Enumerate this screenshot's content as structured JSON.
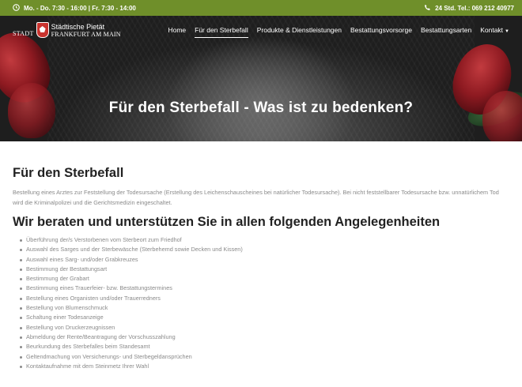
{
  "topbar": {
    "hours": "Mo. - Do. 7:30 - 16:00 | Fr. 7:30 - 14:00",
    "phone": "24 Std. Tel.: 069 212 40977",
    "clock_icon": "clock-icon",
    "phone_icon": "phone-icon"
  },
  "logo": {
    "stadt": "STADT",
    "line1": "Städtische Pietät",
    "line2": "FRANKFURT AM MAIN"
  },
  "nav": {
    "items": [
      {
        "label": "Home"
      },
      {
        "label": "Für den Sterbefall"
      },
      {
        "label": "Produkte & Dienstleistungen"
      },
      {
        "label": "Bestattungsvorsorge"
      },
      {
        "label": "Bestattungsarten"
      },
      {
        "label": "Kontakt"
      }
    ],
    "active_index": 1
  },
  "hero": {
    "title": "Für den Sterbefall - Was ist zu bedenken?"
  },
  "content": {
    "heading1": "Für den Sterbefall",
    "intro": "Bestellung eines Arztes zur Feststellung der Todesursache (Erstellung des Leichenschauscheines bei natürlicher Todesursache). Bei nicht feststellbarer Todesursache bzw. unnatürlichem Tod wird die Kriminalpolizei und die Gerichtsmedizin eingeschaltet.",
    "heading2": "Wir beraten und unterstützen Sie in allen folgenden Angelegenheiten",
    "list": [
      "Überführung der/s Verstorbenen vom Sterbeort zum Friedhof",
      "Auswahl des Sarges und der Sterbewäsche (Sterbehemd sowie Decken und Kissen)",
      "Auswahl eines Sarg- und/oder Grabkreuzes",
      "Bestimmung der Bestattungsart",
      "Bestimmung der Grabart",
      "Bestimmung eines Trauerfeier- bzw. Bestattungstermines",
      "Bestellung eines Organisten und/oder Trauerredners",
      "Bestellung von Blumenschmuck",
      "Schaltung einer Todesanzeige",
      "Bestellung von Druckerzeugnissen",
      "Abmeldung der Rente/Beantragung der Vorschusszahlung",
      "Beurkundung des Sterbefalles beim Standesamt",
      "Geltendmachung von Versicherungs- und Sterbegeldansprüchen",
      "Kontaktaufnahme mit dem Steinmetz Ihrer Wahl"
    ]
  },
  "colors": {
    "topbar_bg": "#6f8f2a",
    "text_dark": "#222222",
    "text_muted": "#8a8a8a"
  }
}
